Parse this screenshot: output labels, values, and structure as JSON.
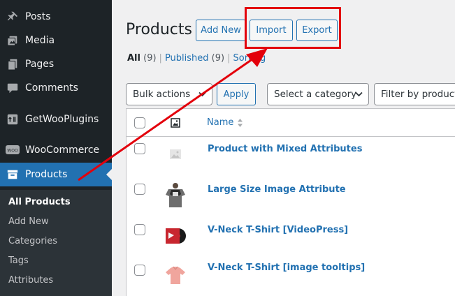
{
  "sidebar": {
    "items": [
      {
        "label": "Posts",
        "icon": "pin-icon"
      },
      {
        "label": "Media",
        "icon": "media-icon"
      },
      {
        "label": "Pages",
        "icon": "pages-icon"
      },
      {
        "label": "Comments",
        "icon": "comment-icon"
      },
      {
        "label": "GetWooPlugins",
        "icon": "plugin-icon"
      },
      {
        "label": "WooCommerce",
        "icon": "woo-icon"
      },
      {
        "label": "Products",
        "icon": "archive-icon"
      }
    ],
    "woo_badge": "WOO",
    "submenu": [
      "All Products",
      "Add New",
      "Categories",
      "Tags",
      "Attributes"
    ],
    "active_color": "#2271b1"
  },
  "header": {
    "title": "Products",
    "add_new": "Add New",
    "import": "Import",
    "export": "Export"
  },
  "filters": {
    "all_label": "All",
    "all_count": "(9)",
    "published_label": "Published",
    "published_count": "(9)",
    "sorting_label": "Sorting",
    "bulk_actions": "Bulk actions",
    "apply": "Apply",
    "category": "Select a category",
    "product_type": "Filter by product t"
  },
  "table": {
    "name_header": "Name",
    "rows": [
      {
        "name": "Product with Mixed Attributes",
        "thumb": "placeholder-image-icon"
      },
      {
        "name": "Large Size Image Attribute",
        "thumb": "tshirt-dark-icon"
      },
      {
        "name": "V-Neck T-Shirt [VideoPress]",
        "thumb": "vinyl-album-icon"
      },
      {
        "name": "V-Neck T-Shirt [image tooltips]",
        "thumb": "tshirt-pink-icon"
      }
    ]
  },
  "annotation": {
    "color": "#e3000b"
  }
}
